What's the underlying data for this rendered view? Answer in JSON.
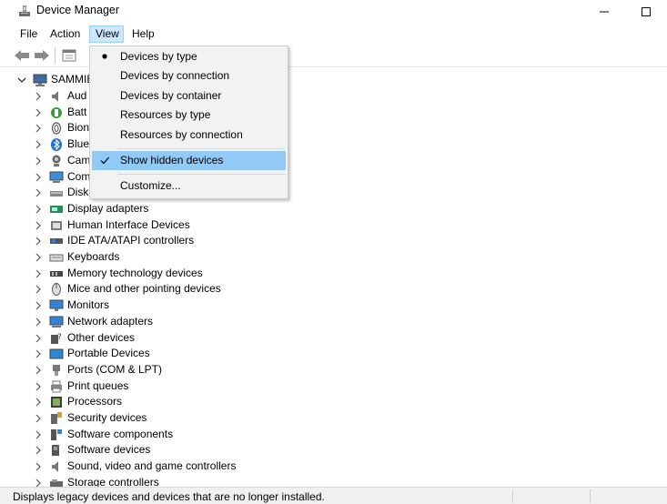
{
  "window": {
    "title": "Device Manager"
  },
  "menubar": {
    "file": "File",
    "action": "Action",
    "view": "View",
    "help": "Help"
  },
  "tree": {
    "root": "SAMMIE",
    "categories": [
      {
        "label": "Aud",
        "icon": "speaker-icon"
      },
      {
        "label": "Batt",
        "icon": "battery-icon"
      },
      {
        "label": "Bion",
        "icon": "fingerprint-icon"
      },
      {
        "label": "Blue",
        "icon": "bluetooth-icon"
      },
      {
        "label": "Cam",
        "icon": "camera-icon"
      },
      {
        "label": "Com",
        "icon": "computer-icon"
      },
      {
        "label": "Disk",
        "icon": "disk-drive-icon"
      },
      {
        "label": "Display adapters",
        "icon": "display-adapter-icon"
      },
      {
        "label": "Human Interface Devices",
        "icon": "hid-icon"
      },
      {
        "label": "IDE ATA/ATAPI controllers",
        "icon": "ide-controller-icon"
      },
      {
        "label": "Keyboards",
        "icon": "keyboard-icon"
      },
      {
        "label": "Memory technology devices",
        "icon": "memory-icon"
      },
      {
        "label": "Mice and other pointing devices",
        "icon": "mouse-icon"
      },
      {
        "label": "Monitors",
        "icon": "monitor-icon"
      },
      {
        "label": "Network adapters",
        "icon": "network-adapter-icon"
      },
      {
        "label": "Other devices",
        "icon": "unknown-device-icon"
      },
      {
        "label": "Portable Devices",
        "icon": "portable-device-icon"
      },
      {
        "label": "Ports (COM & LPT)",
        "icon": "port-icon"
      },
      {
        "label": "Print queues",
        "icon": "printer-icon"
      },
      {
        "label": "Processors",
        "icon": "processor-icon"
      },
      {
        "label": "Security devices",
        "icon": "security-device-icon"
      },
      {
        "label": "Software components",
        "icon": "software-component-icon"
      },
      {
        "label": "Software devices",
        "icon": "software-device-icon"
      },
      {
        "label": "Sound, video and game controllers",
        "icon": "sound-icon"
      },
      {
        "label": "Storage controllers",
        "icon": "storage-controller-icon"
      }
    ]
  },
  "view_menu": {
    "devices_by_type": "Devices by type",
    "devices_by_connection": "Devices by connection",
    "devices_by_container": "Devices by container",
    "resources_by_type": "Resources by type",
    "resources_by_connection": "Resources by connection",
    "show_hidden_devices": "Show hidden devices",
    "customize": "Customize..."
  },
  "status": {
    "text": "Displays legacy devices and devices that are no longer installed."
  },
  "colors": {
    "menu_highlight": "#91c9f7",
    "menubar_active": "#cce8ff",
    "menu_bg": "#f2f2f2"
  }
}
